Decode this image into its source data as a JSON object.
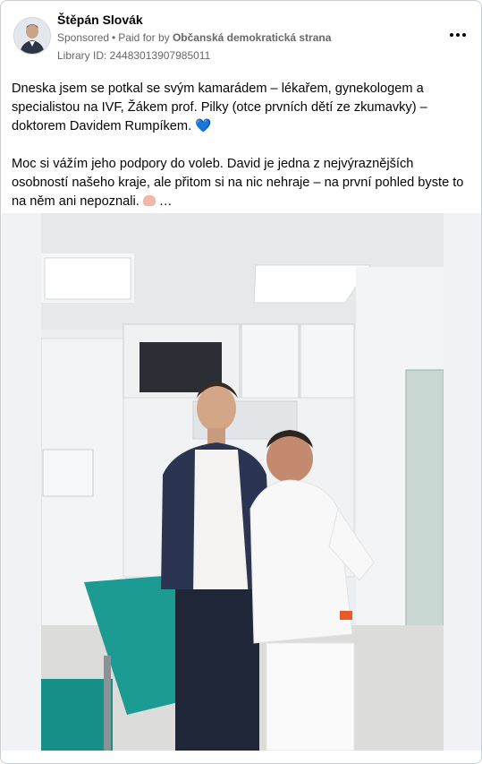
{
  "post": {
    "author_name": "Štěpán Slovák",
    "sponsored_label": "Sponsored",
    "bullet": "•",
    "paid_for_prefix": "Paid for by",
    "paid_for_org": "Občanská demokratická strana",
    "library_id": "Library ID: 24483013907985011",
    "paragraph1": "Dneska jsem se potkal se svým kamarádem – lékařem, gynekologem a specialistou na IVF, Žákem prof. Pilky (otce prvních dětí ze zkumavky) – doktorem Davidem Rumpíkem.",
    "paragraph2": "Moc si vážím jeho podpory do voleb. David je jedna z nejvýraznějších osobností našeho kraje, ale přitom si na nic nehraje – na první pohled byste to na něm ani nepoznali.",
    "heart_emoji": "💙",
    "ellipsis": "…"
  },
  "icons": {
    "more": "more-options-icon",
    "heart": "blue-heart-icon",
    "hand": "raised-hand-icon"
  },
  "colors": {
    "secondary_text": "#65676b",
    "primary_text": "#050505",
    "heart": "#3b8ce8",
    "border": "#c9ccd1"
  }
}
